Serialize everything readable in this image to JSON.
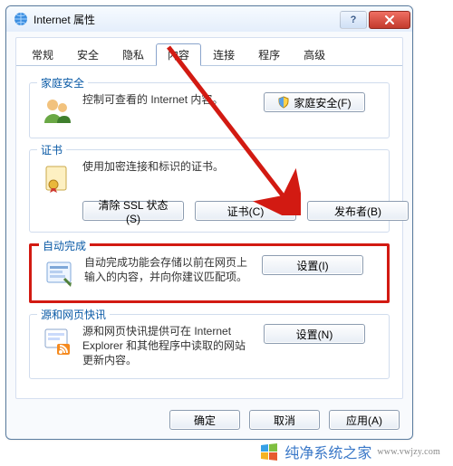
{
  "window": {
    "title": "Internet 属性"
  },
  "tabs": [
    "常规",
    "安全",
    "隐私",
    "内容",
    "连接",
    "程序",
    "高级"
  ],
  "active_tab_index": 3,
  "groups": {
    "family": {
      "legend": "家庭安全",
      "text": "控制可查看的 Internet 内容。",
      "button": "家庭安全(F)"
    },
    "cert": {
      "legend": "证书",
      "text": "使用加密连接和标识的证书。",
      "buttons": {
        "clear_ssl": "清除 SSL 状态(S)",
        "certs": "证书(C)",
        "publishers": "发布者(B)"
      }
    },
    "autocomplete": {
      "legend": "自动完成",
      "text": "自动完成功能会存储以前在网页上输入的内容，并向你建议匹配项。",
      "button": "设置(I)"
    },
    "feeds": {
      "legend": "源和网页快讯",
      "text": "源和网页快讯提供可在 Internet Explorer 和其他程序中读取的网站更新内容。",
      "button": "设置(N)"
    }
  },
  "footer": {
    "ok": "确定",
    "cancel": "取消",
    "apply": "应用(A)"
  },
  "watermark": {
    "brand": "纯净系统之家",
    "url": "www.vwjzy.com"
  }
}
